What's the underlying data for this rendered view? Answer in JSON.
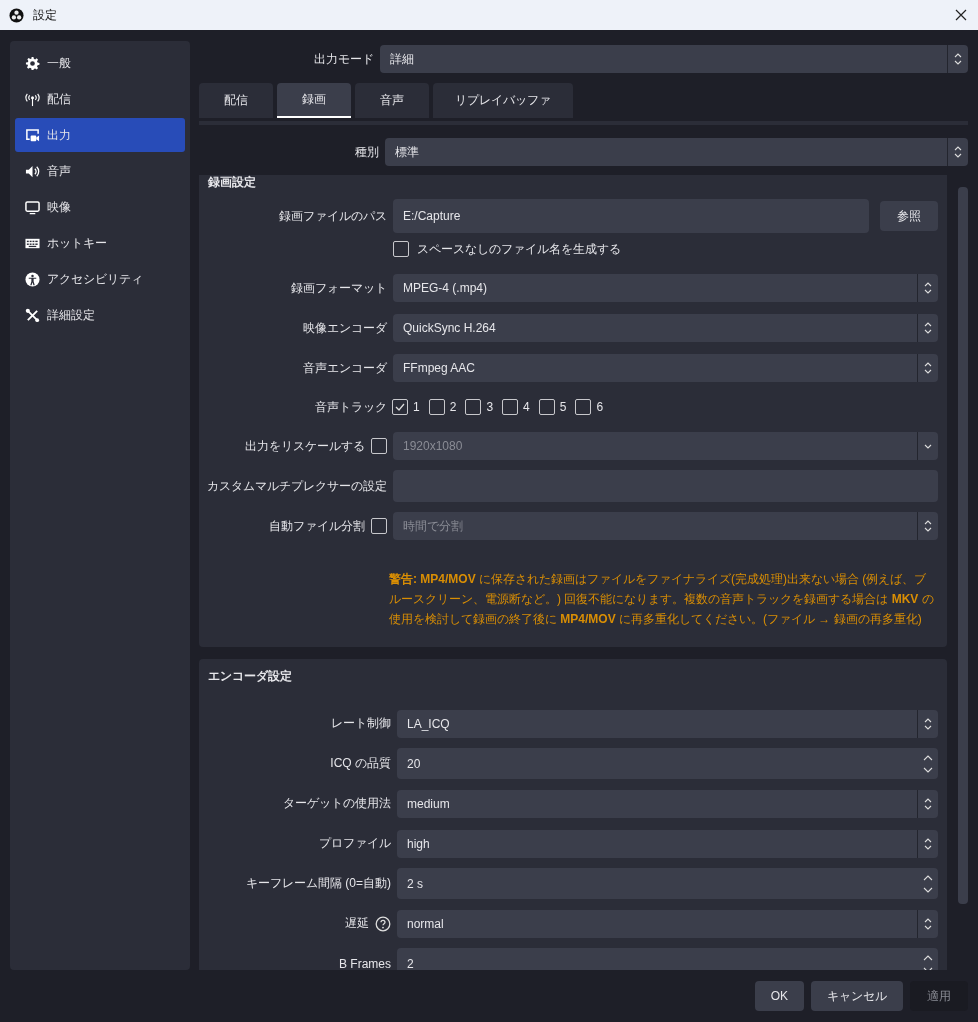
{
  "window": {
    "title": "設定"
  },
  "sidebar": {
    "items": [
      {
        "label": "一般",
        "kind": "gear",
        "selected": false
      },
      {
        "label": "配信",
        "kind": "antenna",
        "selected": false
      },
      {
        "label": "出力",
        "kind": "output",
        "selected": true
      },
      {
        "label": "音声",
        "kind": "speaker",
        "selected": false
      },
      {
        "label": "映像",
        "kind": "monitor",
        "selected": false
      },
      {
        "label": "ホットキー",
        "kind": "keyboard",
        "selected": false
      },
      {
        "label": "アクセシビリティ",
        "kind": "accessibility",
        "selected": false
      },
      {
        "label": "詳細設定",
        "kind": "tools",
        "selected": false
      }
    ]
  },
  "output_mode": {
    "label": "出力モード",
    "value": "詳細"
  },
  "tabs": [
    {
      "label": "配信",
      "selected": false
    },
    {
      "label": "録画",
      "selected": true
    },
    {
      "label": "音声",
      "selected": false
    },
    {
      "label": "リプレイバッファ",
      "selected": false
    }
  ],
  "type_row": {
    "label": "種別",
    "value": "標準"
  },
  "recording": {
    "title": "録画設定",
    "rows": [
      {
        "kind": "path",
        "label": "録画ファイルのパス",
        "value": "E:/Capture",
        "button": "参照"
      },
      {
        "kind": "check",
        "label": "スペースなしのファイル名を生成する",
        "checked": false
      },
      {
        "kind": "select",
        "label": "録画フォーマット",
        "value": "MPEG-4 (.mp4)"
      },
      {
        "kind": "select",
        "label": "映像エンコーダ",
        "value": "QuickSync H.264"
      },
      {
        "kind": "select",
        "label": "音声エンコーダ",
        "value": "FFmpeg AAC"
      },
      {
        "kind": "tracks",
        "label": "音声トラック",
        "tracks": [
          {
            "label": "1",
            "checked": true
          },
          {
            "label": "2",
            "checked": false
          },
          {
            "label": "3",
            "checked": false
          },
          {
            "label": "4",
            "checked": false
          },
          {
            "label": "5",
            "checked": false
          },
          {
            "label": "6",
            "checked": false
          }
        ]
      },
      {
        "kind": "check_dropdown",
        "label": "出力をリスケールする",
        "checked": false,
        "value": "1920x1080"
      },
      {
        "kind": "text",
        "label": "カスタムマルチプレクサーの設定"
      },
      {
        "kind": "check_select",
        "label": "自動ファイル分割",
        "checked": false,
        "value": "時間で分割"
      }
    ],
    "warning": "**警告: MP4/MOV** に保存された録画はファイルをファイナライズ(完成処理)出来ない場合 (例えば、ブルースクリーン、電源断など。) 回復不能になります。複数の音声トラックを録画する場合は **MKV** の使用を検討して録画の終了後に **MP4/MOV** に再多重化してください。(ファイル → 録画の再多重化)"
  },
  "encoder": {
    "title": "エンコーダ設定",
    "rows": [
      {
        "kind": "select",
        "label": "レート制御",
        "value": "LA_ICQ"
      },
      {
        "kind": "spin",
        "label": "ICQ の品質",
        "value": "20"
      },
      {
        "kind": "select",
        "label": "ターゲットの使用法",
        "value": "medium"
      },
      {
        "kind": "select",
        "label": "プロファイル",
        "value": "high"
      },
      {
        "kind": "spin",
        "label": "キーフレーム間隔 (0=自動)",
        "value": "2 s"
      },
      {
        "kind": "select",
        "label": "遅延",
        "value": "normal",
        "help": true
      },
      {
        "kind": "spin",
        "label": "B Frames",
        "value": "2"
      }
    ]
  },
  "buttons": [
    {
      "label": "OK",
      "disabled": false
    },
    {
      "label": "キャンセル",
      "disabled": false
    },
    {
      "label": "適用",
      "disabled": true
    }
  ]
}
